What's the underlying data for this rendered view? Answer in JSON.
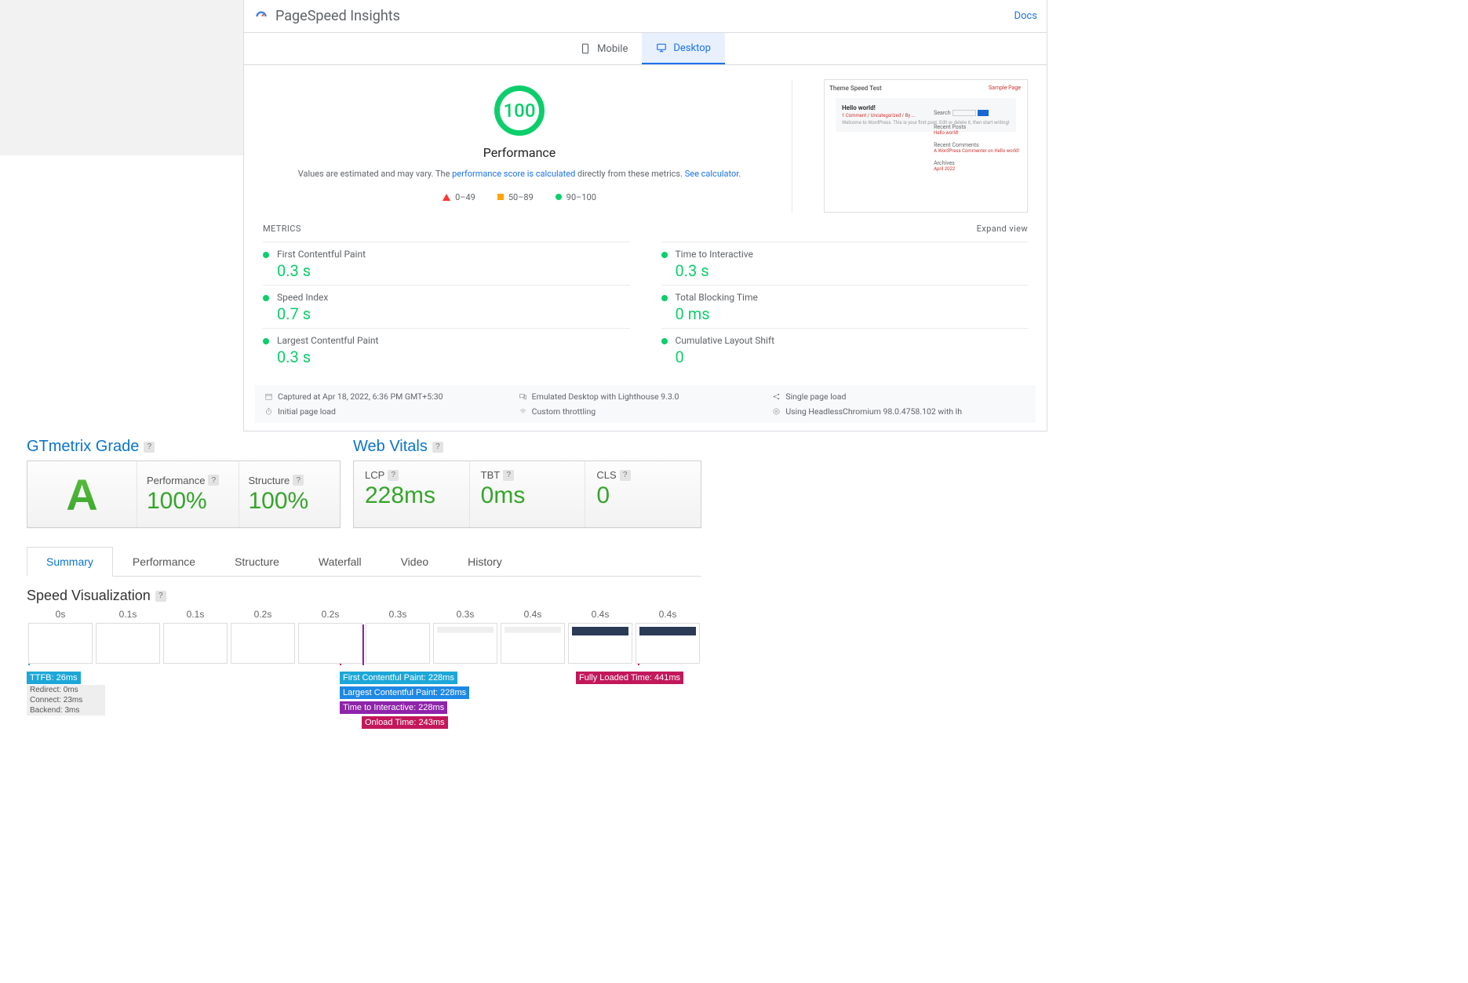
{
  "psi": {
    "title": "PageSpeed Insights",
    "docs": "Docs",
    "tabs": {
      "mobile": "Mobile",
      "desktop": "Desktop"
    },
    "score": "100",
    "score_label": "Performance",
    "note_pre": "Values are estimated and may vary. The ",
    "note_link1": "performance score is calculated",
    "note_mid": " directly from these metrics. ",
    "note_link2": "See calculator.",
    "legend": {
      "fail": "0–49",
      "avg": "50–89",
      "pass": "90–100"
    },
    "screenshot": {
      "title": "Theme Speed Test",
      "sample": "Sample Page",
      "card_title": "Hello world!",
      "card_sub": "1 Comment / Uncategorized / By ...",
      "card_body": "Welcome to WordPress. This is your first post. Edit or delete it, then start writing!",
      "side": {
        "search": "Search",
        "recent_posts": "Recent Posts",
        "hello": "Hello world!",
        "recent_comments": "Recent Comments",
        "comment_line": "A WordPress Commenter on Hello world!",
        "archives": "Archives",
        "april": "April 2022"
      }
    },
    "metrics_head": "METRICS",
    "expand": "Expand view",
    "metrics": [
      {
        "name": "First Contentful Paint",
        "value": "0.3 s"
      },
      {
        "name": "Time to Interactive",
        "value": "0.3 s"
      },
      {
        "name": "Speed Index",
        "value": "0.7 s"
      },
      {
        "name": "Total Blocking Time",
        "value": "0 ms"
      },
      {
        "name": "Largest Contentful Paint",
        "value": "0.3 s"
      },
      {
        "name": "Cumulative Layout Shift",
        "value": "0"
      }
    ],
    "env": {
      "captured": "Captured at Apr 18, 2022, 6:36 PM GMT+5:30",
      "emulated": "Emulated Desktop with Lighthouse 9.3.0",
      "single": "Single page load",
      "initial": "Initial page load",
      "throttle": "Custom throttling",
      "chrome": "Using HeadlessChromium 98.0.4758.102 with lh"
    }
  },
  "gt": {
    "grade_title": "GTmetrix Grade",
    "vitals_title": "Web Vitals",
    "grade": "A",
    "performance_label": "Performance",
    "performance_value": "100%",
    "structure_label": "Structure",
    "structure_value": "100%",
    "vitals": {
      "lcp_label": "LCP",
      "lcp_value": "228ms",
      "tbt_label": "TBT",
      "tbt_value": "0ms",
      "cls_label": "CLS",
      "cls_value": "0"
    },
    "tabs": [
      "Summary",
      "Performance",
      "Structure",
      "Waterfall",
      "Video",
      "History"
    ],
    "sv_title": "Speed Visualization",
    "frames": [
      "0s",
      "0.1s",
      "0.1s",
      "0.2s",
      "0.2s",
      "0.3s",
      "0.3s",
      "0.4s",
      "0.4s",
      "0.4s"
    ],
    "tags": {
      "ttfb": "TTFB: 26ms",
      "redirect": "Redirect: 0ms",
      "connect": "Connect: 23ms",
      "backend": "Backend: 3ms",
      "fcp": "First Contentful Paint: 228ms",
      "lcp": "Largest Contentful Paint: 228ms",
      "tti": "Time to Interactive: 228ms",
      "onload": "Onload Time: 243ms",
      "flt": "Fully Loaded Time: 441ms"
    }
  }
}
